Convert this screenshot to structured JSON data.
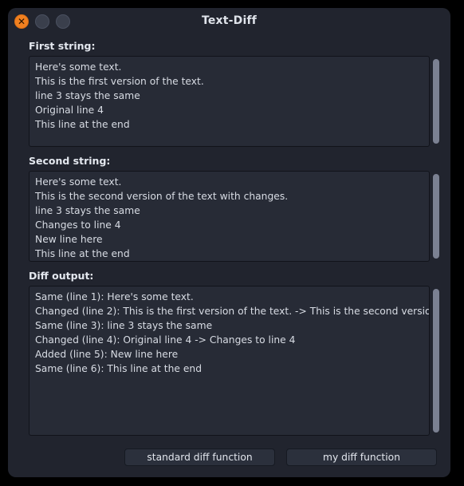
{
  "window": {
    "title": "Text-Diff",
    "controls": {
      "close_glyph": "✕",
      "close_name": "close-button",
      "minimize_name": "minimize-button",
      "maximize_name": "maximize-button"
    },
    "colors": {
      "background": "#21242e",
      "desktop": "#000000",
      "close_button": "#f08020",
      "inactive_button": "#3a3f4c",
      "field_background": "#272b36",
      "text": "#d8dce4",
      "title_text": "#dfe3ea",
      "scrollbar_thumb": "#7b8192",
      "button_face": "#2b303c"
    }
  },
  "sections": {
    "first": {
      "label": "First string:",
      "value": "Here's some text.\nThis is the first version of the text.\nline 3 stays the same\nOriginal line 4\nThis line at the end"
    },
    "second": {
      "label": "Second string:",
      "value": "Here's some text.\nThis is the second version of the text with changes.\nline 3 stays the same\nChanges to line 4\nNew line here\nThis line at the end"
    },
    "diff": {
      "label": "Diff output:",
      "value": "Same (line 1): Here's some text.\nChanged (line 2): This is the first version of the text. -> This is the second version of the text with changes.\nSame (line 3): line 3 stays the same\nChanged (line 4): Original line 4 -> Changes to line 4\nAdded (line 5): New line here\nSame (line 6): This line at the end"
    }
  },
  "buttons": {
    "standard": "standard diff function",
    "mine": "my diff function"
  }
}
